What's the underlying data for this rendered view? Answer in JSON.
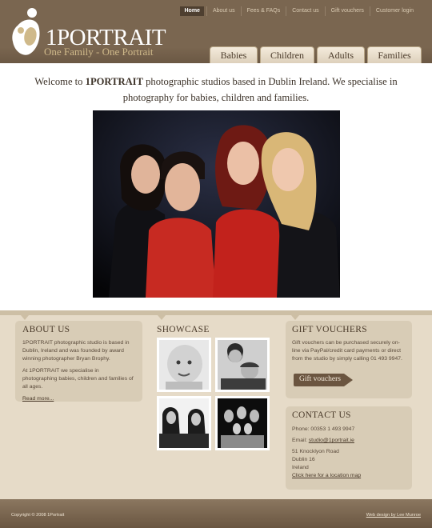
{
  "brand": {
    "name": "1PORTRAIT",
    "tagline": "One Family - One Portrait",
    "accent": "#cfb98a",
    "header_bg": "#7a6650"
  },
  "top_nav": [
    "Home",
    "About us",
    "Fees & FAQs",
    "Contact us",
    "Gift vouchers",
    "Customer login"
  ],
  "tabs": [
    "Babies",
    "Children",
    "Adults",
    "Families"
  ],
  "intro": {
    "before": "Welcome to ",
    "brand": "1PORTRAIT",
    "after": " photographic studios based in Dublin Ireland. We specialise in photography for babies, children and families."
  },
  "about": {
    "title": "ABOUT US",
    "p1": "1PORTRAIT photographic studio is based in Dublin, Ireland and was founded by award winning photographer Bryan Brophy.",
    "p2": "At 1PORTRAIT we specialise in photographing babies, children and families of all ages.",
    "read_more": "Read more..."
  },
  "showcase": {
    "title": "SHOWCASE"
  },
  "gift": {
    "title": "GIFT VOUCHERS",
    "text": "Gift vouchers can be purchased securely on-line via PayPal/credit card payments or direct from the studio by simply calling 01 493 9947.",
    "button": "Gift vouchers"
  },
  "contact": {
    "title": "CONTACT US",
    "phone": "Phone: 00353 1 493 9947",
    "email_label": "Email: ",
    "email": "studio@1portrait.ie",
    "address1": "51 Knocklyon Road",
    "address2": "Dublin 16",
    "address3": "Ireland",
    "map_link": "Click here for a location map"
  },
  "footer": {
    "copyright": "Copyright © 2008 1Portrait",
    "credit": "Web design by Lee Munroe"
  }
}
